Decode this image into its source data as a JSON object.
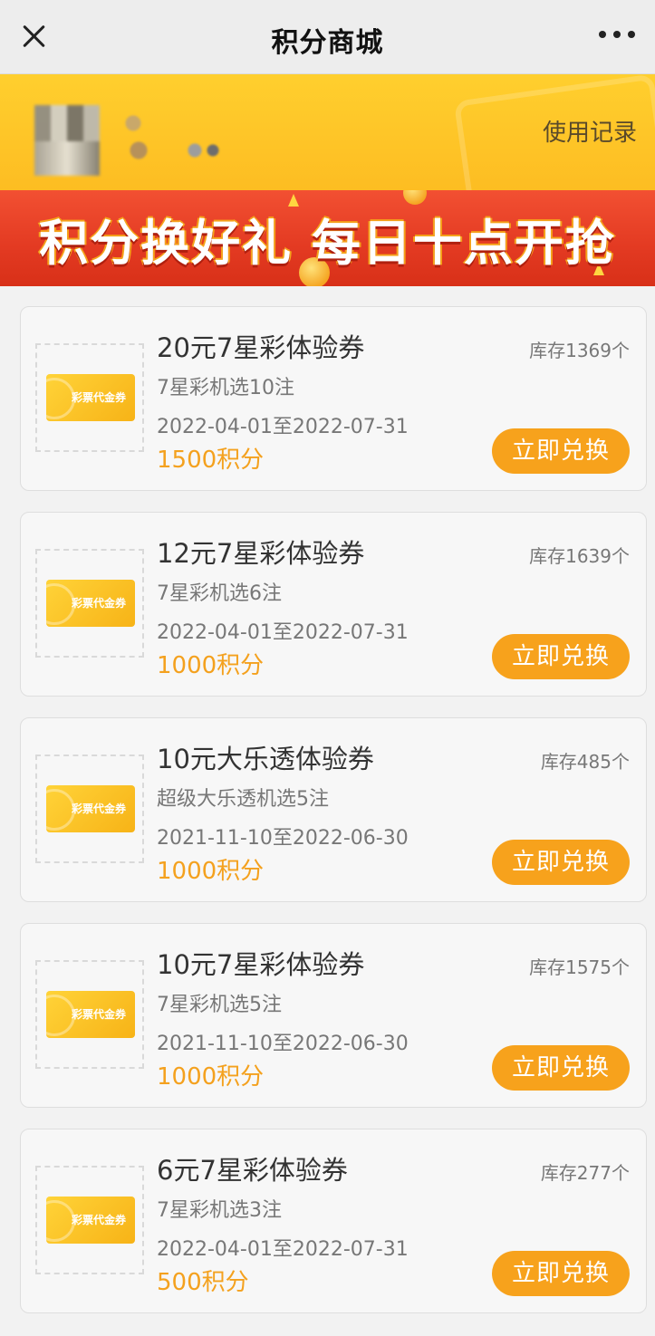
{
  "header": {
    "title": "积分商城",
    "close_icon": "close-icon",
    "more_icon": "more-icon"
  },
  "user": {
    "usage_link": "使用记录"
  },
  "banner": {
    "text": "积分换好礼  每日十点开抢"
  },
  "colors": {
    "accent": "#f7a21c",
    "banner_red": "#e33a22",
    "header_yellow": "#fdbd22"
  },
  "items": [
    {
      "title": "20元7星彩体验券",
      "stock": "库存1369个",
      "desc": "7星彩机选10注",
      "validity": "2022-04-01至2022-07-31",
      "points": "1500积分",
      "button": "立即兑换",
      "voucher_label": "彩票代金券"
    },
    {
      "title": "12元7星彩体验券",
      "stock": "库存1639个",
      "desc": "7星彩机选6注",
      "validity": "2022-04-01至2022-07-31",
      "points": "1000积分",
      "button": "立即兑换",
      "voucher_label": "彩票代金券"
    },
    {
      "title": "10元大乐透体验券",
      "stock": "库存485个",
      "desc": "超级大乐透机选5注",
      "validity": "2021-11-10至2022-06-30",
      "points": "1000积分",
      "button": "立即兑换",
      "voucher_label": "彩票代金券"
    },
    {
      "title": "10元7星彩体验券",
      "stock": "库存1575个",
      "desc": "7星彩机选5注",
      "validity": "2021-11-10至2022-06-30",
      "points": "1000积分",
      "button": "立即兑换",
      "voucher_label": "彩票代金券"
    },
    {
      "title": "6元7星彩体验券",
      "stock": "库存277个",
      "desc": "7星彩机选3注",
      "validity": "2022-04-01至2022-07-31",
      "points": "500积分",
      "button": "立即兑换",
      "voucher_label": "彩票代金券"
    }
  ]
}
